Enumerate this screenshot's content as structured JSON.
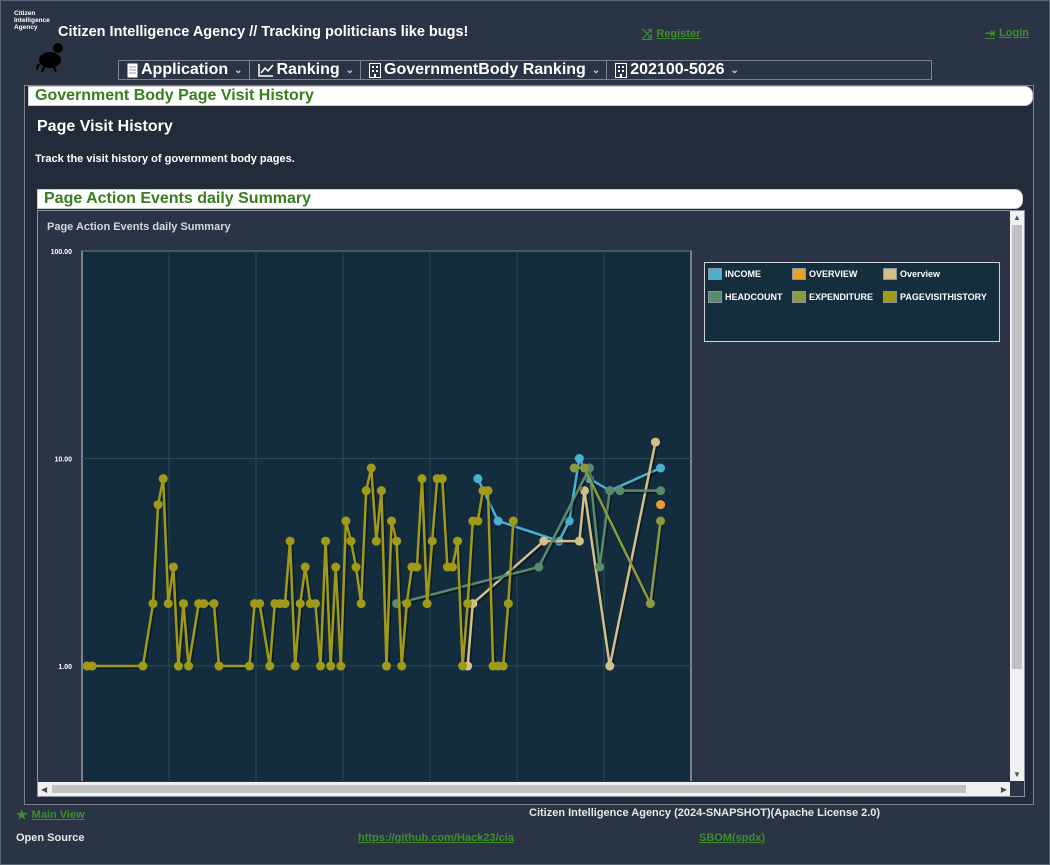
{
  "app": {
    "logo_text": [
      "Citizen",
      "Intelligence",
      "Agency"
    ],
    "title": "Citizen Intelligence Agency  // Tracking politicians like bugs!",
    "register_label": "Register",
    "login_label": "Login"
  },
  "menu": [
    {
      "label": "Application",
      "icon": "document-icon"
    },
    {
      "label": "Ranking",
      "icon": "chart-line-icon"
    },
    {
      "label": "GovernmentBody Ranking",
      "icon": "building-icon"
    },
    {
      "label": "202100-5026",
      "icon": "building-icon"
    }
  ],
  "main": {
    "panel_title": "Government Body Page Visit History",
    "heading": "Page Visit History",
    "description": "Track the visit history of government body pages.",
    "chart_panel_title": "Page Action Events daily Summary"
  },
  "chart_data": {
    "type": "line",
    "title": "Page Action Events daily Summary",
    "y_scale": "log",
    "ylim": [
      0.25,
      100
    ],
    "y_ticks": [
      "100.00",
      "10.00",
      "1.00"
    ],
    "grid": true,
    "legend_position": "right",
    "series": [
      {
        "name": "INCOME",
        "color": "#4ab0d0",
        "points": [
          [
            78,
            8
          ],
          [
            82,
            5
          ],
          [
            94,
            4
          ],
          [
            96,
            5
          ],
          [
            98,
            10
          ],
          [
            100,
            8
          ],
          [
            104,
            7
          ],
          [
            114,
            9
          ]
        ]
      },
      {
        "name": "OVERVIEW",
        "color": "#e8a030",
        "points": [
          [
            114,
            6
          ]
        ]
      },
      {
        "name": "Overview",
        "color": "#d4be8a",
        "points": [
          [
            76,
            1
          ],
          [
            77,
            2
          ],
          [
            91,
            4
          ],
          [
            98,
            4
          ],
          [
            99,
            7
          ],
          [
            104,
            1
          ],
          [
            113,
            12
          ]
        ]
      },
      {
        "name": "HEADCOUNT",
        "color": "#5a8a6a",
        "points": [
          [
            62,
            2
          ],
          [
            90,
            3
          ],
          [
            100,
            9
          ],
          [
            102,
            3
          ],
          [
            104,
            7
          ],
          [
            106,
            7
          ],
          [
            114,
            7
          ]
        ]
      },
      {
        "name": "EXPENDITURE",
        "color": "#8a9a40",
        "points": [
          [
            97,
            9
          ],
          [
            99,
            9
          ],
          [
            112,
            2
          ],
          [
            114,
            5
          ]
        ]
      },
      {
        "name": "PAGEVISITHISTORY",
        "color": "#a09a18",
        "points": [
          [
            1,
            1
          ],
          [
            2,
            1
          ],
          [
            12,
            1
          ],
          [
            14,
            2
          ],
          [
            15,
            6
          ],
          [
            16,
            8
          ],
          [
            17,
            2
          ],
          [
            18,
            3
          ],
          [
            19,
            1
          ],
          [
            20,
            2
          ],
          [
            21,
            1
          ],
          [
            23,
            2
          ],
          [
            24,
            2
          ],
          [
            26,
            2
          ],
          [
            27,
            1
          ],
          [
            33,
            1
          ],
          [
            34,
            2
          ],
          [
            35,
            2
          ],
          [
            37,
            1
          ],
          [
            38,
            2
          ],
          [
            39,
            2
          ],
          [
            40,
            2
          ],
          [
            41,
            4
          ],
          [
            42,
            1
          ],
          [
            43,
            2
          ],
          [
            44,
            3
          ],
          [
            45,
            2
          ],
          [
            46,
            2
          ],
          [
            47,
            1
          ],
          [
            48,
            4
          ],
          [
            49,
            1
          ],
          [
            50,
            3
          ],
          [
            51,
            1
          ],
          [
            52,
            5
          ],
          [
            53,
            4
          ],
          [
            54,
            3
          ],
          [
            55,
            2
          ],
          [
            56,
            7
          ],
          [
            57,
            9
          ],
          [
            58,
            4
          ],
          [
            59,
            7
          ],
          [
            60,
            1
          ],
          [
            61,
            5
          ],
          [
            62,
            4
          ],
          [
            63,
            1
          ],
          [
            64,
            2
          ],
          [
            65,
            3
          ],
          [
            66,
            3
          ],
          [
            67,
            8
          ],
          [
            68,
            2
          ],
          [
            69,
            4
          ],
          [
            70,
            8
          ],
          [
            71,
            8
          ],
          [
            72,
            3
          ],
          [
            73,
            3
          ],
          [
            74,
            4
          ],
          [
            75,
            1
          ],
          [
            76,
            2
          ],
          [
            77,
            5
          ],
          [
            78,
            5
          ],
          [
            79,
            7
          ],
          [
            80,
            7
          ],
          [
            81,
            1
          ],
          [
            82,
            1
          ],
          [
            83,
            1
          ],
          [
            84,
            2
          ],
          [
            85,
            5
          ]
        ]
      }
    ]
  },
  "footer": {
    "main_view": "Main View",
    "version": "Citizen Intelligence Agency (2024-SNAPSHOT)(Apache License 2.0)",
    "open_source": "Open Source",
    "github": "https://github.com/Hack23/cia",
    "sbom": "SBOM(spdx)"
  }
}
